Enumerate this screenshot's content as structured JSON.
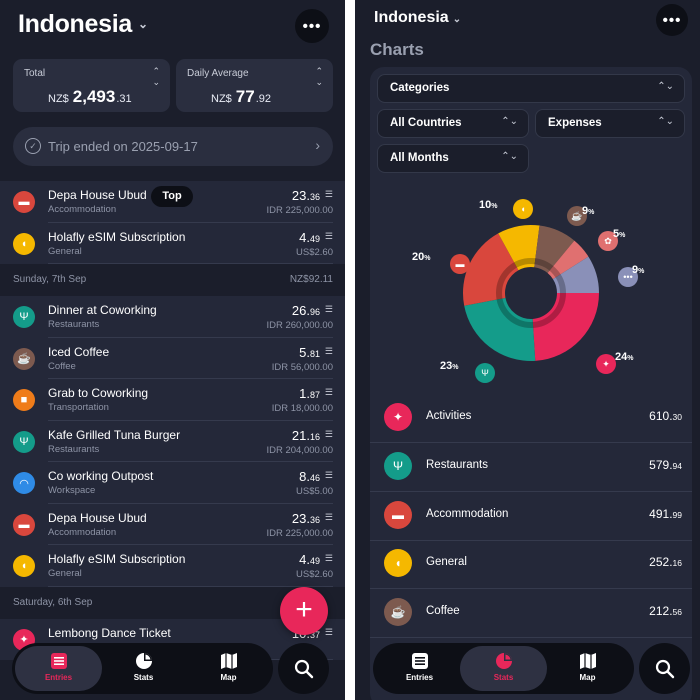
{
  "left": {
    "trip_title": "Indonesia",
    "total": {
      "label": "Total",
      "currency": "NZ$",
      "whole": "2,493",
      "cents": ".31"
    },
    "daily": {
      "label": "Daily Average",
      "currency": "NZ$",
      "whole": "77",
      "cents": ".92"
    },
    "trip_status": "Trip ended on 2025-09-17",
    "top_pill": "Top",
    "entries_a": [
      {
        "name": "Depa House Ubud",
        "category": "Accommodation",
        "amount": "23.",
        "cents": "36",
        "original": "IDR 225,000.00",
        "color": "#d9473d",
        "icon": "bed-icon",
        "glyph": "▬"
      },
      {
        "name": "Holafly eSIM Subscription",
        "category": "General",
        "amount": "4.",
        "cents": "49",
        "original": "US$2.60",
        "color": "#f5b800",
        "icon": "tag-icon",
        "glyph": "◖"
      }
    ],
    "day1": {
      "label": "Sunday, 7th Sep",
      "total": "NZ$92.11"
    },
    "entries_b": [
      {
        "name": "Dinner at Coworking",
        "category": "Restaurants",
        "amount": "26.",
        "cents": "96",
        "original": "IDR 260,000.00",
        "color": "#149c8a",
        "icon": "fork-knife-icon",
        "glyph": "Ψ"
      },
      {
        "name": "Iced Coffee",
        "category": "Coffee",
        "amount": "5.",
        "cents": "81",
        "original": "IDR 56,000.00",
        "color": "#7d5a4f",
        "icon": "coffee-icon",
        "glyph": "☕"
      },
      {
        "name": "Grab to Coworking",
        "category": "Transportation",
        "amount": "1.",
        "cents": "87",
        "original": "IDR 18,000.00",
        "color": "#ef7c1a",
        "icon": "bus-icon",
        "glyph": "■"
      },
      {
        "name": "Kafe Grilled Tuna Burger",
        "category": "Restaurants",
        "amount": "21.",
        "cents": "16",
        "original": "IDR 204,000.00",
        "color": "#149c8a",
        "icon": "fork-knife-icon",
        "glyph": "Ψ"
      },
      {
        "name": "Co working Outpost",
        "category": "Workspace",
        "amount": "8.",
        "cents": "46",
        "original": "US$5.00",
        "color": "#2f8be6",
        "icon": "wifi-icon",
        "glyph": "◠"
      },
      {
        "name": "Depa House Ubud",
        "category": "Accommodation",
        "amount": "23.",
        "cents": "36",
        "original": "IDR 225,000.00",
        "color": "#d9473d",
        "icon": "bed-icon",
        "glyph": "▬"
      },
      {
        "name": "Holafly eSIM Subscription",
        "category": "General",
        "amount": "4.",
        "cents": "49",
        "original": "US$2.60",
        "color": "#f5b800",
        "icon": "tag-icon",
        "glyph": "◖"
      }
    ],
    "day2": {
      "label": "Saturday, 6th Sep"
    },
    "entries_c": [
      {
        "name": "Lembong Dance Ticket",
        "category": "",
        "amount": "10.",
        "cents": "37",
        "original": "",
        "color": "#e8275a",
        "icon": "ticket-icon",
        "glyph": "✦"
      }
    ],
    "tabs": [
      {
        "label": "Entries"
      },
      {
        "label": "Stats"
      },
      {
        "label": "Map"
      }
    ]
  },
  "right": {
    "trip_title": "Indonesia",
    "section": "Charts",
    "filters": {
      "group": "Categories",
      "country": "All Countries",
      "type": "Expenses",
      "period": "All Months"
    },
    "tabs": [
      {
        "label": "Entries"
      },
      {
        "label": "Stats"
      },
      {
        "label": "Map"
      }
    ],
    "categories": [
      {
        "name": "Activities",
        "whole": "610.",
        "cents": "30",
        "color": "#e8275a",
        "icon": "running-icon",
        "glyph": "✦"
      },
      {
        "name": "Restaurants",
        "whole": "579.",
        "cents": "94",
        "color": "#149c8a",
        "icon": "fork-knife-icon",
        "glyph": "Ψ"
      },
      {
        "name": "Accommodation",
        "whole": "491.",
        "cents": "99",
        "color": "#d9473d",
        "icon": "bed-icon",
        "glyph": "▬"
      },
      {
        "name": "General",
        "whole": "252.",
        "cents": "16",
        "color": "#f5b800",
        "icon": "tag-icon",
        "glyph": "◖"
      },
      {
        "name": "Coffee",
        "whole": "212.",
        "cents": "56",
        "color": "#7d5a4f",
        "icon": "coffee-icon",
        "glyph": "☕"
      }
    ],
    "donut": [
      {
        "pct": "24",
        "color": "#e8275a",
        "icon": "running-icon",
        "glyph": "✦"
      },
      {
        "pct": "23",
        "color": "#149c8a",
        "icon": "fork-knife-icon",
        "glyph": "Ψ"
      },
      {
        "pct": "20",
        "color": "#d9473d",
        "icon": "bed-icon",
        "glyph": "▬"
      },
      {
        "pct": "10",
        "color": "#f5b800",
        "icon": "tag-icon",
        "glyph": "◖"
      },
      {
        "pct": "9",
        "color": "#7d5a4f",
        "icon": "coffee-icon",
        "glyph": "☕"
      },
      {
        "pct": "5",
        "color": "#e07070",
        "icon": "spa-icon",
        "glyph": "✿"
      },
      {
        "pct": "9",
        "color": "#8a90b8",
        "icon": "more-icon",
        "glyph": "•••"
      }
    ],
    "percent_sign": "%"
  }
}
